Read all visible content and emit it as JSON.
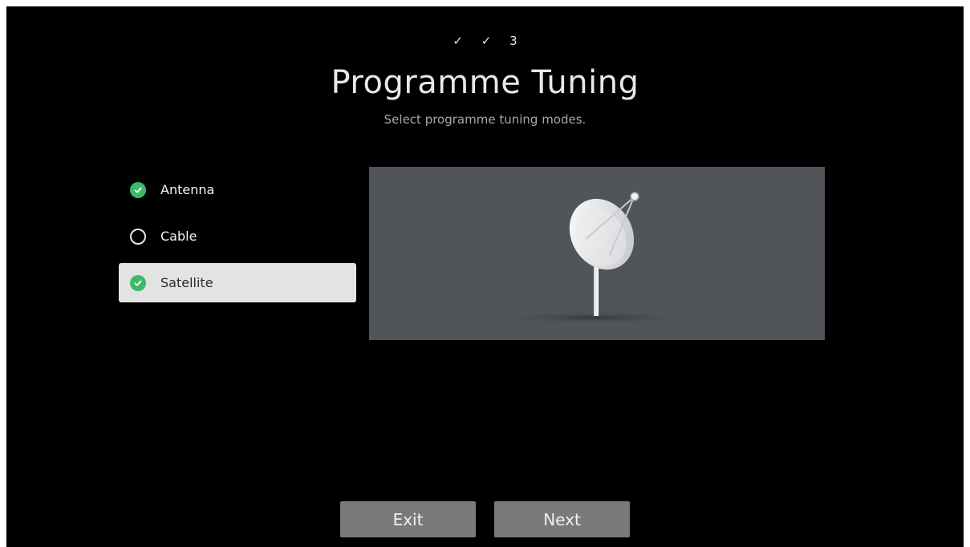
{
  "steps": [
    "✓",
    "✓",
    "3"
  ],
  "title": "Programme Tuning",
  "subtitle": "Select programme tuning modes.",
  "options": [
    {
      "label": "Antenna",
      "checked": true,
      "focused": false
    },
    {
      "label": "Cable",
      "checked": false,
      "focused": false
    },
    {
      "label": "Satellite",
      "checked": true,
      "focused": true
    }
  ],
  "illustration": {
    "icon": "satellite-dish-icon"
  },
  "buttons": {
    "exit": "Exit",
    "next": "Next"
  },
  "colors": {
    "background": "#000000",
    "check_green": "#3cba6b",
    "focus_bg": "#e3e3e3",
    "panel_bg": "#515459",
    "button_bg": "#7a7a7a"
  }
}
